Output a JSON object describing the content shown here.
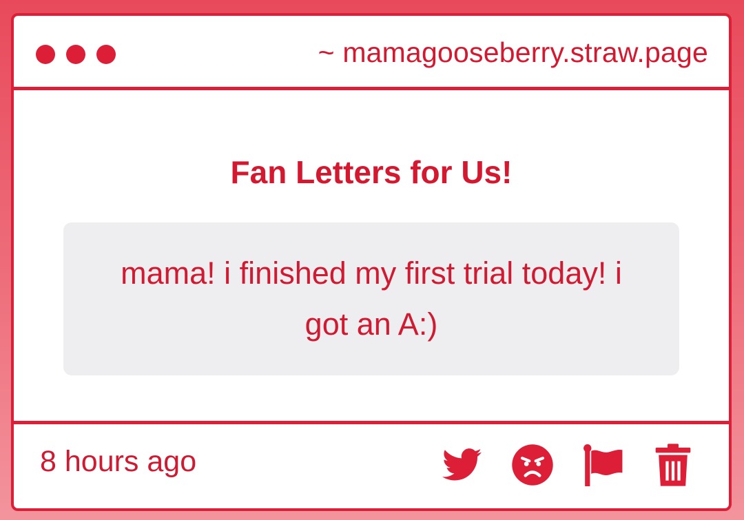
{
  "window": {
    "url": "~ mamagooseberry.straw.page"
  },
  "page": {
    "heading": "Fan Letters for Us!",
    "message": "mama! i finished my first trial today! i got an A:)"
  },
  "footer": {
    "timestamp": "8 hours ago",
    "actions": [
      {
        "name": "twitter-share",
        "icon": "twitter-bird-icon"
      },
      {
        "name": "angry-react",
        "icon": "angry-face-icon"
      },
      {
        "name": "report-flag",
        "icon": "flag-icon"
      },
      {
        "name": "delete",
        "icon": "trash-icon"
      }
    ]
  },
  "colors": {
    "accent": "#dc1e36",
    "text": "#d4182f",
    "message_bg": "#eeedef",
    "page_bg": "#e84a5b"
  }
}
